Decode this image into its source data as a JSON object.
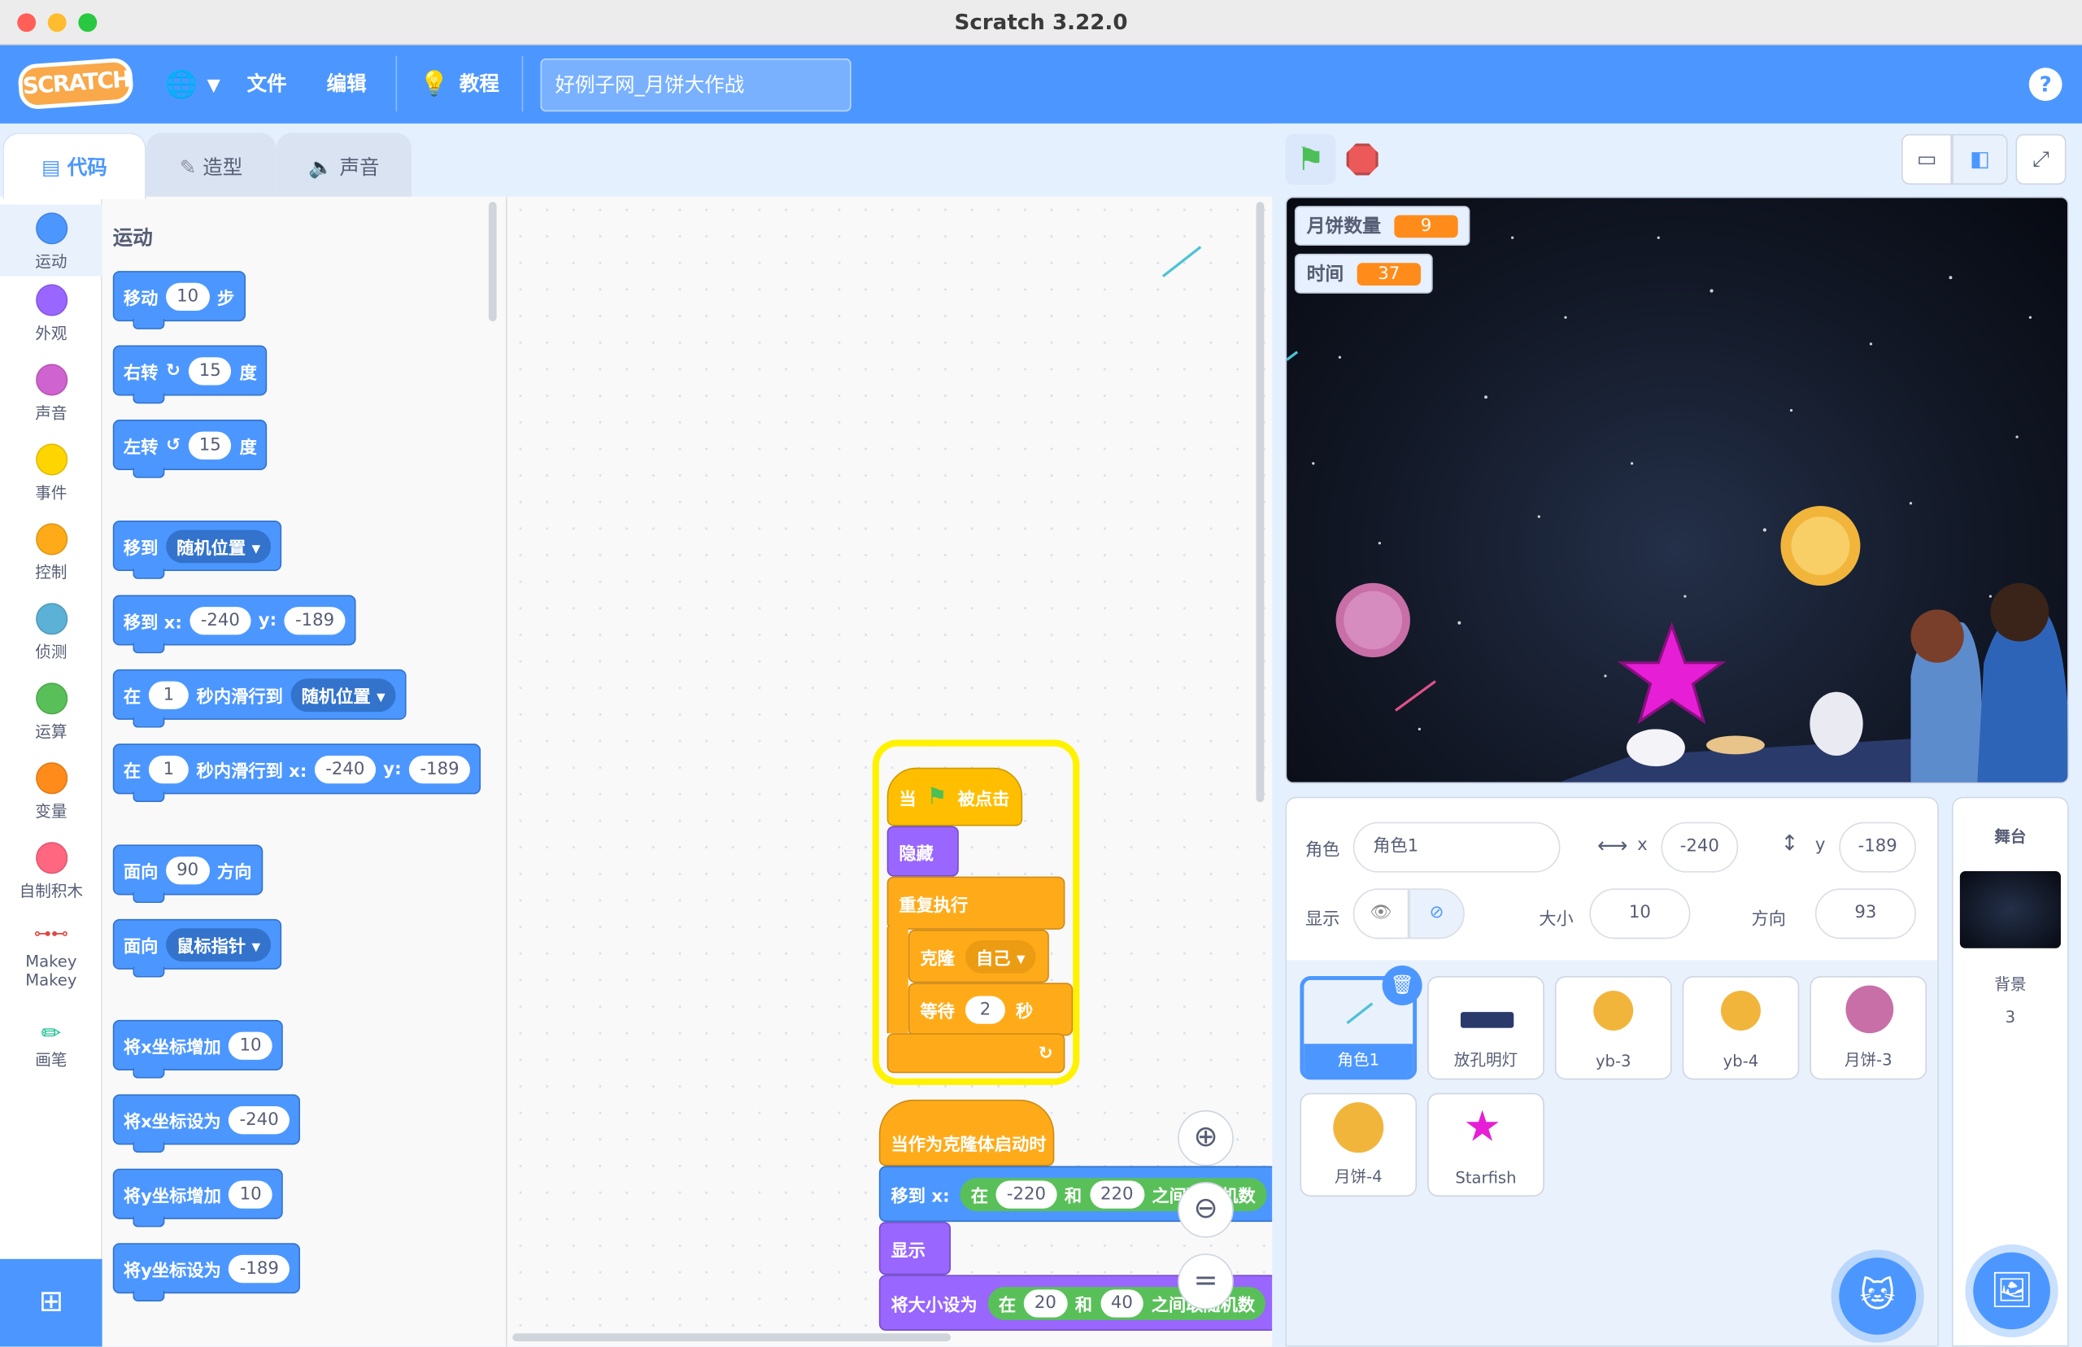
{
  "window": {
    "title": "Scratch 3.22.0"
  },
  "menu": {
    "logo": "SCRATCH",
    "file": "文件",
    "edit": "编辑",
    "tutorials": "教程",
    "project_title": "好例子网_月饼大作战",
    "help": "?"
  },
  "tabs": {
    "code": "代码",
    "costumes": "造型",
    "sounds": "声音"
  },
  "categories": [
    {
      "label": "运动",
      "color": "#4c97ff"
    },
    {
      "label": "外观",
      "color": "#9966ff"
    },
    {
      "label": "声音",
      "color": "#cf63cf"
    },
    {
      "label": "事件",
      "color": "#ffd500"
    },
    {
      "label": "控制",
      "color": "#ffab19"
    },
    {
      "label": "侦测",
      "color": "#5cb1d6"
    },
    {
      "label": "运算",
      "color": "#59c059"
    },
    {
      "label": "变量",
      "color": "#ff8c1a"
    },
    {
      "label": "自制积木",
      "color": "#ff6680"
    },
    {
      "label": "Makey Makey"
    },
    {
      "label": "画笔"
    }
  ],
  "palette": {
    "heading": "运动",
    "move": {
      "a": "移动",
      "v": "10",
      "b": "步"
    },
    "turn_right": {
      "a": "右转",
      "v": "15",
      "b": "度"
    },
    "turn_left": {
      "a": "左转",
      "v": "15",
      "b": "度"
    },
    "goto": {
      "a": "移到",
      "d": "随机位置"
    },
    "goto_xy": {
      "a": "移到 x:",
      "x": "-240",
      "y_lbl": "y:",
      "y": "-189"
    },
    "glide": {
      "a": "在",
      "v": "1",
      "b": "秒内滑行到",
      "d": "随机位置"
    },
    "glide_xy": {
      "a": "在",
      "v": "1",
      "b": "秒内滑行到 x:",
      "x": "-240",
      "y_lbl": "y:",
      "y": "-189"
    },
    "point": {
      "a": "面向",
      "v": "90",
      "b": "方向"
    },
    "point_towards": {
      "a": "面向",
      "d": "鼠标指针"
    },
    "change_x": {
      "a": "将x坐标增加",
      "v": "10"
    },
    "set_x": {
      "a": "将x坐标设为",
      "v": "-240"
    },
    "change_y": {
      "a": "将y坐标增加",
      "v": "10"
    },
    "set_y": {
      "a": "将y坐标设为",
      "v": "-189"
    }
  },
  "script": {
    "hat": {
      "a": "当",
      "b": "被点击"
    },
    "hide": "隐藏",
    "forever": "重复执行",
    "clone": {
      "a": "克隆",
      "d": "自己"
    },
    "wait": {
      "a": "等待",
      "v": "2",
      "b": "秒"
    },
    "clone_hat": "当作为克隆体启动时",
    "goto": {
      "a": "移到 x:",
      "b": "在",
      "v1": "-220",
      "c": "和",
      "v2": "220",
      "d": "之间取随机数"
    },
    "show": "显示",
    "size": {
      "a": "将大小设为",
      "b": "在",
      "v1": "20",
      "c": "和",
      "v2": "40",
      "d": "之间取随机数"
    }
  },
  "monitors": [
    {
      "label": "月饼数量",
      "value": "9"
    },
    {
      "label": "时间",
      "value": "37"
    }
  ],
  "sprite_info": {
    "sprite_lbl": "角色",
    "sprite_name": "角色1",
    "x_lbl": "x",
    "x": "-240",
    "y_lbl": "y",
    "y": "-189",
    "show_lbl": "显示",
    "size_lbl": "大小",
    "size": "10",
    "dir_lbl": "方向",
    "dir": "93"
  },
  "sprites": [
    {
      "name": "角色1"
    },
    {
      "name": "放孔明灯"
    },
    {
      "name": "yb-3"
    },
    {
      "name": "yb-4"
    },
    {
      "name": "月饼-3"
    },
    {
      "name": "月饼-4"
    },
    {
      "name": "Starfish"
    }
  ],
  "stage_pane": {
    "title": "舞台",
    "backdrops_lbl": "背景",
    "backdrops_count": "3"
  }
}
